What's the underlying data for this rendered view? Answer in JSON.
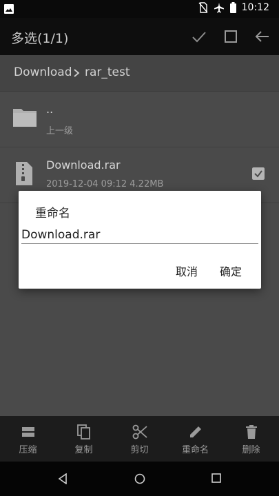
{
  "status_bar": {
    "time": "10:12"
  },
  "appbar": {
    "title": "多选(1/1)"
  },
  "breadcrumb": {
    "items": [
      "Download",
      "rar_test"
    ]
  },
  "list": [
    {
      "name": "..",
      "sub": "上一级",
      "icon": "folder-icon"
    },
    {
      "name": "Download.rar",
      "sub": "2019-12-04 09:12  4.22MB",
      "icon": "archive-file-icon",
      "checked": true
    }
  ],
  "dialog": {
    "title": "重命名",
    "value": "Download.rar",
    "cancel_label": "取消",
    "ok_label": "确定"
  },
  "toolbar": {
    "items": [
      {
        "label": "压缩",
        "icon": "compress-icon"
      },
      {
        "label": "复制",
        "icon": "copy-icon"
      },
      {
        "label": "剪切",
        "icon": "cut-icon"
      },
      {
        "label": "重命名",
        "icon": "edit-icon"
      },
      {
        "label": "删除",
        "icon": "delete-icon"
      }
    ]
  },
  "colors": {
    "accent_dialog": "#ffffff",
    "scrim": "#4a4a4a",
    "toolbar_bg": "#1c1c1c"
  }
}
